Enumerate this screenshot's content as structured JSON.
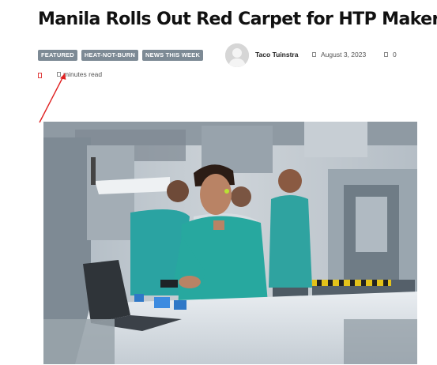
{
  "article": {
    "title": "Manila Rolls Out Red Carpet for HTP Makers",
    "tags": [
      "FEATURED",
      "HEAT-NOT-BURN",
      "NEWS THIS WEEK"
    ],
    "author": "Taco Tuinstra",
    "date": "August 3, 2023",
    "comments": "0",
    "read_time": "minutes read"
  },
  "icons": {
    "avatar": "user-avatar-placeholder",
    "date": "calendar-icon",
    "comments": "comment-icon",
    "read_time": "clock-icon"
  },
  "colors": {
    "tag_bg": "#7d8a95",
    "annotation": "#e02020"
  }
}
